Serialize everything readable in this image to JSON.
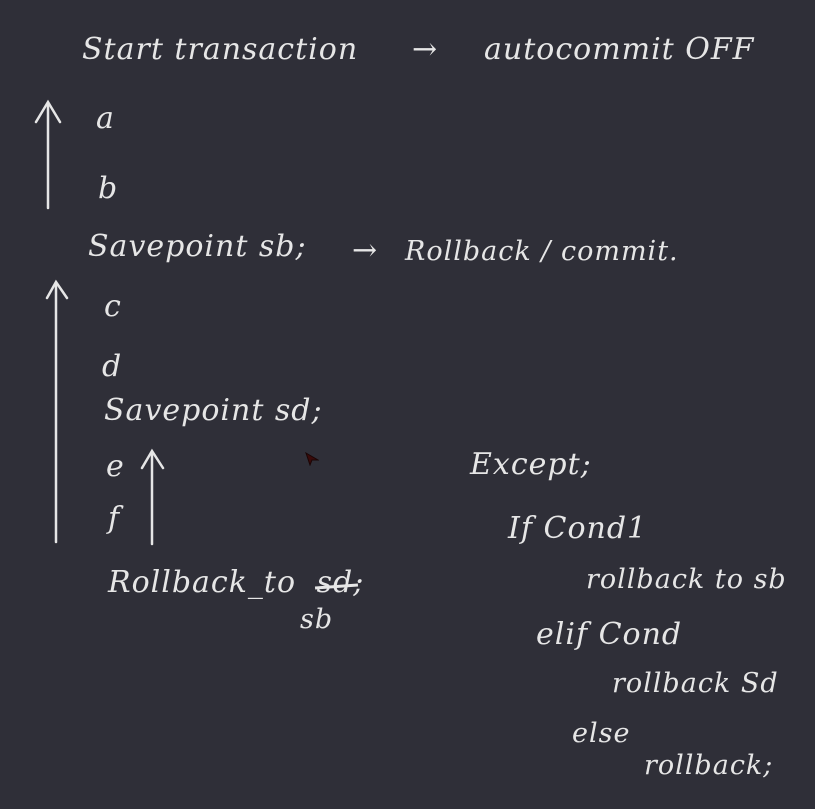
{
  "board": {
    "line1": "Start transaction",
    "line1_arrow": "→",
    "line1_note": "autocommit OFF",
    "item_a": "a",
    "item_b": "b",
    "savepoint_sb": "Savepoint sb;",
    "savepoint_sb_arrow": "→",
    "savepoint_sb_note": "Rollback / commit.",
    "item_c": "c",
    "item_d": "d",
    "savepoint_sd": "Savepoint sd;",
    "item_e": "e",
    "item_f": "f",
    "rollback_prefix": "Rollback_to",
    "rollback_struck": "sd",
    "rollback_semicolon": ";",
    "rollback_correction": "sb",
    "except_label": "Except;",
    "if_cond": "If Cond1",
    "if_action": "rollback to sb",
    "elif_cond": "elif Cond",
    "elif_action": "rollback Sd",
    "else_label": "else",
    "else_action": "rollback;"
  },
  "colors": {
    "background": "#2f2f38",
    "ink": "#e6e6e6",
    "cursor": "#3a0a0a"
  },
  "icons": {
    "arrows": "up-arrow",
    "pointer": "mouse-cursor-icon"
  }
}
